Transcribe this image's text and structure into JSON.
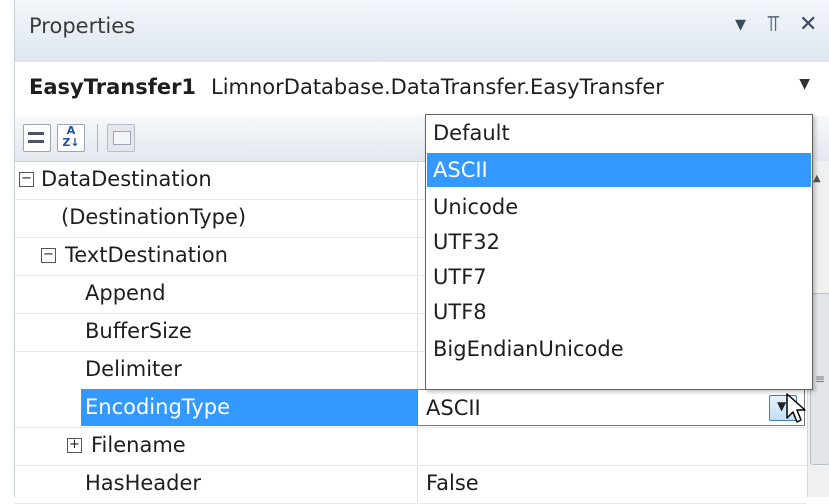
{
  "panel": {
    "title": "Properties",
    "buttons": {
      "dropdown": "▾",
      "pin": "⫪",
      "close": "✕"
    }
  },
  "object_selector": {
    "name": "EasyTransfer1",
    "type": "LimnorDatabase.DataTransfer.EasyTransfer",
    "arrow": "▼"
  },
  "toolbar": {
    "alpha_glyph_top": "A",
    "alpha_glyph_bottom": "Z↓"
  },
  "grid": {
    "rows": [
      {
        "name": "DataDestination",
        "value": "",
        "expander": "−"
      },
      {
        "name": "(DestinationType)",
        "value": "",
        "expander": ""
      },
      {
        "name": "TextDestination",
        "value": "",
        "expander": "−"
      },
      {
        "name": "Append",
        "value": "",
        "expander": ""
      },
      {
        "name": "BufferSize",
        "value": "",
        "expander": ""
      },
      {
        "name": "Delimiter",
        "value": "",
        "expander": ""
      },
      {
        "name": "EncodingType",
        "value": "ASCII",
        "expander": ""
      },
      {
        "name": "Filename",
        "value": "",
        "expander": "+"
      },
      {
        "name": "HasHeader",
        "value": "False",
        "expander": ""
      }
    ]
  },
  "dropdown": {
    "selected": "ASCII",
    "options": [
      "Default",
      "ASCII",
      "Unicode",
      "UTF32",
      "UTF7",
      "UTF8",
      "BigEndianUnicode"
    ]
  },
  "scrollbar": {
    "up_arrow": "▲",
    "grip": "≡"
  },
  "colors": {
    "selection": "#3399ff",
    "titlebar": "#dfe6ef"
  }
}
